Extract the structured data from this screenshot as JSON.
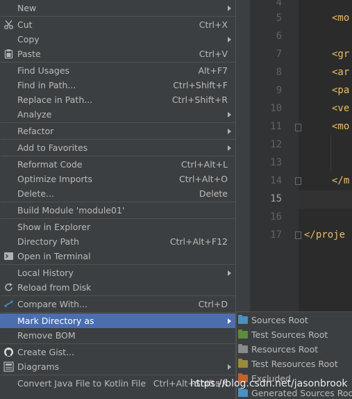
{
  "editor": {
    "line_numbers": [
      "4",
      "5",
      "6",
      "7",
      "8",
      "9",
      "10",
      "11",
      "12",
      "13",
      "14",
      "15",
      "16",
      "17"
    ],
    "active_line": "15",
    "code_lines": [
      "<mo",
      "<gr",
      "<ar",
      "<pa",
      "<ve",
      "<mo",
      "</m",
      "</proje"
    ]
  },
  "menu": {
    "items": [
      {
        "label": "New",
        "shortcut": "",
        "icon": "",
        "submenu": true
      },
      {
        "label": "Cut",
        "shortcut": "Ctrl+X",
        "icon": "scissors-icon",
        "submenu": false
      },
      {
        "label": "Copy",
        "shortcut": "",
        "icon": "",
        "submenu": true
      },
      {
        "label": "Paste",
        "shortcut": "Ctrl+V",
        "icon": "clipboard-icon",
        "submenu": false
      },
      {
        "label": "Find Usages",
        "shortcut": "Alt+F7",
        "icon": "",
        "submenu": false
      },
      {
        "label": "Find in Path...",
        "shortcut": "Ctrl+Shift+F",
        "icon": "",
        "submenu": false
      },
      {
        "label": "Replace in Path...",
        "shortcut": "Ctrl+Shift+R",
        "icon": "",
        "submenu": false
      },
      {
        "label": "Analyze",
        "shortcut": "",
        "icon": "",
        "submenu": true
      },
      {
        "label": "Refactor",
        "shortcut": "",
        "icon": "",
        "submenu": true
      },
      {
        "label": "Add to Favorites",
        "shortcut": "",
        "icon": "",
        "submenu": true
      },
      {
        "label": "Reformat Code",
        "shortcut": "Ctrl+Alt+L",
        "icon": "",
        "submenu": false
      },
      {
        "label": "Optimize Imports",
        "shortcut": "Ctrl+Alt+O",
        "icon": "",
        "submenu": false
      },
      {
        "label": "Delete...",
        "shortcut": "Delete",
        "icon": "",
        "submenu": false
      },
      {
        "label": "Build Module 'module01'",
        "shortcut": "",
        "icon": "",
        "submenu": false
      },
      {
        "label": "Show in Explorer",
        "shortcut": "",
        "icon": "",
        "submenu": false
      },
      {
        "label": "Directory Path",
        "shortcut": "Ctrl+Alt+F12",
        "icon": "",
        "submenu": false
      },
      {
        "label": "Open in Terminal",
        "shortcut": "",
        "icon": "terminal-icon",
        "submenu": false
      },
      {
        "label": "Local History",
        "shortcut": "",
        "icon": "",
        "submenu": true
      },
      {
        "label": "Reload from Disk",
        "shortcut": "",
        "icon": "reload-icon",
        "submenu": false
      },
      {
        "label": "Compare With...",
        "shortcut": "Ctrl+D",
        "icon": "compare-icon",
        "submenu": false
      },
      {
        "label": "Mark Directory as",
        "shortcut": "",
        "icon": "",
        "submenu": true,
        "selected": true
      },
      {
        "label": "Remove BOM",
        "shortcut": "",
        "icon": "",
        "submenu": false
      },
      {
        "label": "Create Gist...",
        "shortcut": "",
        "icon": "github-icon",
        "submenu": false
      },
      {
        "label": "Diagrams",
        "shortcut": "",
        "icon": "diagram-icon",
        "submenu": true
      },
      {
        "label": "Convert Java File to Kotlin File",
        "shortcut": "Ctrl+Alt+Shift+K",
        "icon": "",
        "submenu": false
      }
    ]
  },
  "submenu": {
    "items": [
      {
        "label": "Sources Root",
        "icon": "sources-root-folder-icon",
        "color": "#4a90c2"
      },
      {
        "label": "Test Sources Root",
        "icon": "test-sources-root-folder-icon",
        "color": "#5e8c3a"
      },
      {
        "label": "Resources Root",
        "icon": "resources-root-folder-icon",
        "color": "#8a8a8a"
      },
      {
        "label": "Test Resources Root",
        "icon": "test-resources-root-folder-icon",
        "color": "#9c8a3c"
      },
      {
        "label": "Excluded",
        "icon": "excluded-folder-icon",
        "color": "#c0642a"
      },
      {
        "label": "Generated Sources Root",
        "icon": "generated-sources-root-folder-icon",
        "color": "#4a90c2"
      }
    ]
  },
  "watermark": "https://blog.csdn.net/jasonbrook",
  "colors": {
    "menu_bg": "#3c3f41",
    "selection": "#4b6eaf",
    "separator": "#515151",
    "code_tag": "#e8bf6a"
  }
}
